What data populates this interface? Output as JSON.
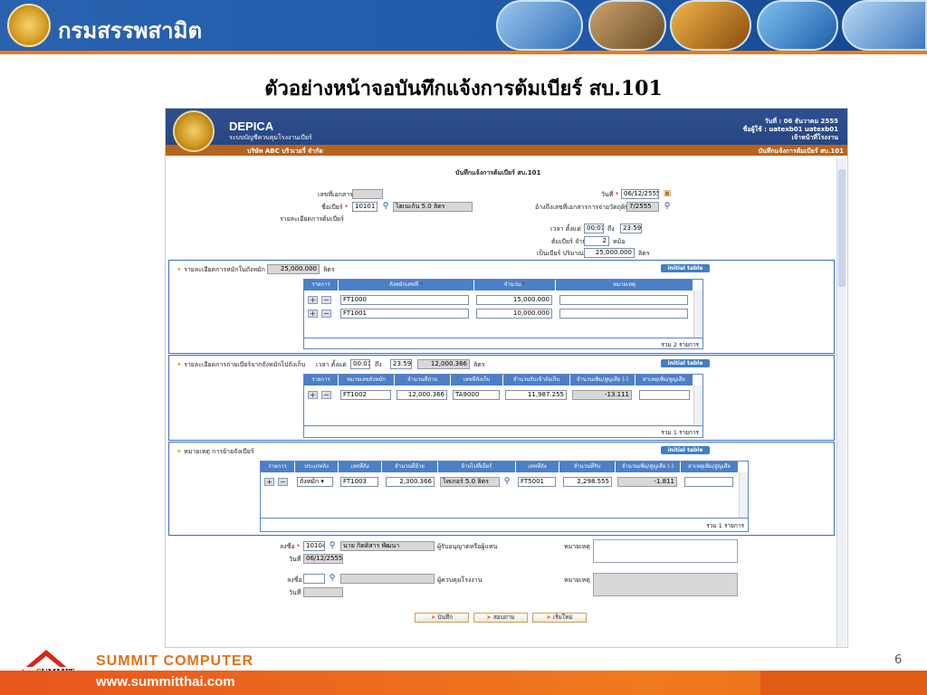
{
  "slide": {
    "agency": "กรมสรรพสามิต",
    "title": "ตัวอย่างหน้าจอบันทึกแจ้งการต้มเบียร์ สบ.101",
    "company": "SUMMIT COMPUTER",
    "url": "www.summitthai.com",
    "page_number": "6"
  },
  "app": {
    "name": "DEPICA",
    "subtitle": "ระบบบัญชีควบคุมโรงงานเบียร์",
    "company": "บริษัท ABC บริวเวอรี่ จำกัด",
    "date_line": "วันที่ : 06 ธันวาคม 2555",
    "user_line": "ชื่อผู้ใช้ : uatexb01 uatexb01",
    "role_line": "เจ้าหน้าที่โรงงาน",
    "page_name": "บันทึกแจ้งการต้มเบียร์ สบ.101"
  },
  "form": {
    "heading": "บันทึกแจ้งการต้มเบียร์ สบ.101",
    "doc_no_label": "เลขที่เอกสาร",
    "doc_no_value": "",
    "beer_name_label": "ชื่อเบียร์",
    "beer_code": "10101",
    "beer_name": "ไฮเนเก้น 5.0 ลิตร",
    "beer_detail_label": "รายละเอียดการต้มเบียร์",
    "date_label": "วันที่",
    "date_value": "06/12/2555",
    "ref_doc_label": "อ้างถึงเลขที่เอกสารการจ่ายวัตถุดิบ",
    "ref_doc_value": "7/2555",
    "start_time_label": "เวลา ตั้งแต่",
    "start_time": "00:01",
    "to_label": "ถึง",
    "end_time": "23:59",
    "brew_count_label": "ต้มเบียร์ จำนวน",
    "brew_count": "2",
    "brew_unit": "หม้อ",
    "volume_label": "เป็นเบียร์ ปริมาณ",
    "volume": "25,000.000",
    "volume_unit": "ลิตร"
  },
  "section1": {
    "title": "รายละเอียดการหมักในถังหมัก",
    "total": "25,000.000",
    "unit": "ลิตร",
    "init_label": "initial table",
    "columns": [
      "รายการ",
      "ถังหมักเลขที่",
      "จำนวน",
      "หมายเหตุ"
    ],
    "rows": [
      {
        "tank": "FT1000",
        "qty": "15,000.000",
        "note": ""
      },
      {
        "tank": "FT1001",
        "qty": "10,000.000",
        "note": ""
      }
    ],
    "footer": "รวม 2 รายการ"
  },
  "section2": {
    "title": "รายละเอียดการถ่ายเบียร์จากถังหมักไปถังเก็บ",
    "time_label": "เวลา ตั้งแต่",
    "start": "00:01",
    "to_label": "ถึง",
    "end": "23:59",
    "total": "12,000.366",
    "unit": "ลิตร",
    "init_label": "initial table",
    "columns": [
      "รายการ",
      "หมายเลขถังหมัก",
      "จำนวนที่ถ่าย",
      "เลขที่ถังเก็บ",
      "จำนวนรับเข้าถังเก็บ",
      "จำนวนเพิ่ม/สูญเสีย (-)",
      "สาเหตุเพิ่ม/สูญเสีย"
    ],
    "rows": [
      {
        "ferm": "FT1002",
        "transfer": "12,000.366",
        "storage": "TA9000",
        "received": "11,987.255",
        "diff": "-13.111",
        "reason": ""
      }
    ],
    "footer": "รวม 1 รายการ"
  },
  "section3": {
    "title": "หมายเหตุ การย้ายถังเบียร์",
    "init_label": "initial table",
    "columns": [
      "รายการ",
      "ประเภทถัง",
      "เลขที่ถัง",
      "จำนวนที่ย้าย",
      "ย้ายไปที่เบียร์",
      "เลขที่ถัง",
      "จำนวนที่รับ",
      "จำนวนเพิ่ม/สูญเสีย (-)",
      "สาเหตุเพิ่ม/สูญเสีย"
    ],
    "rows": [
      {
        "type": "ถังหมัก",
        "tank": "FT1003",
        "qty": "2,300.366",
        "beer": "ไทเกอร์ 5.0 ลิตร",
        "tank2": "FT5001",
        "received": "2,298.555",
        "diff": "-1.811",
        "reason": ""
      }
    ],
    "footer": "รวม 1 รายการ"
  },
  "sign": {
    "sign_label": "ลงชื่อ",
    "code1": "10104",
    "name1": "นาย กิตติสาร พัฒนา",
    "role1": "ผู้รับอนุญาตหรือผู้แทน",
    "date_label": "วันที่",
    "date1": "06/12/2555",
    "note_label": "หมายเหตุ",
    "code2": "",
    "name2": "",
    "role2": "ผู้ควบคุมโรงงาน",
    "date2": ""
  },
  "buttons": {
    "save": "บันทึก",
    "query": "สอบถาม",
    "reset": "เริ่มใหม่"
  },
  "colors": {
    "accent": "#3a6bc4",
    "header": "#22447f",
    "orange": "#f07a1e"
  }
}
